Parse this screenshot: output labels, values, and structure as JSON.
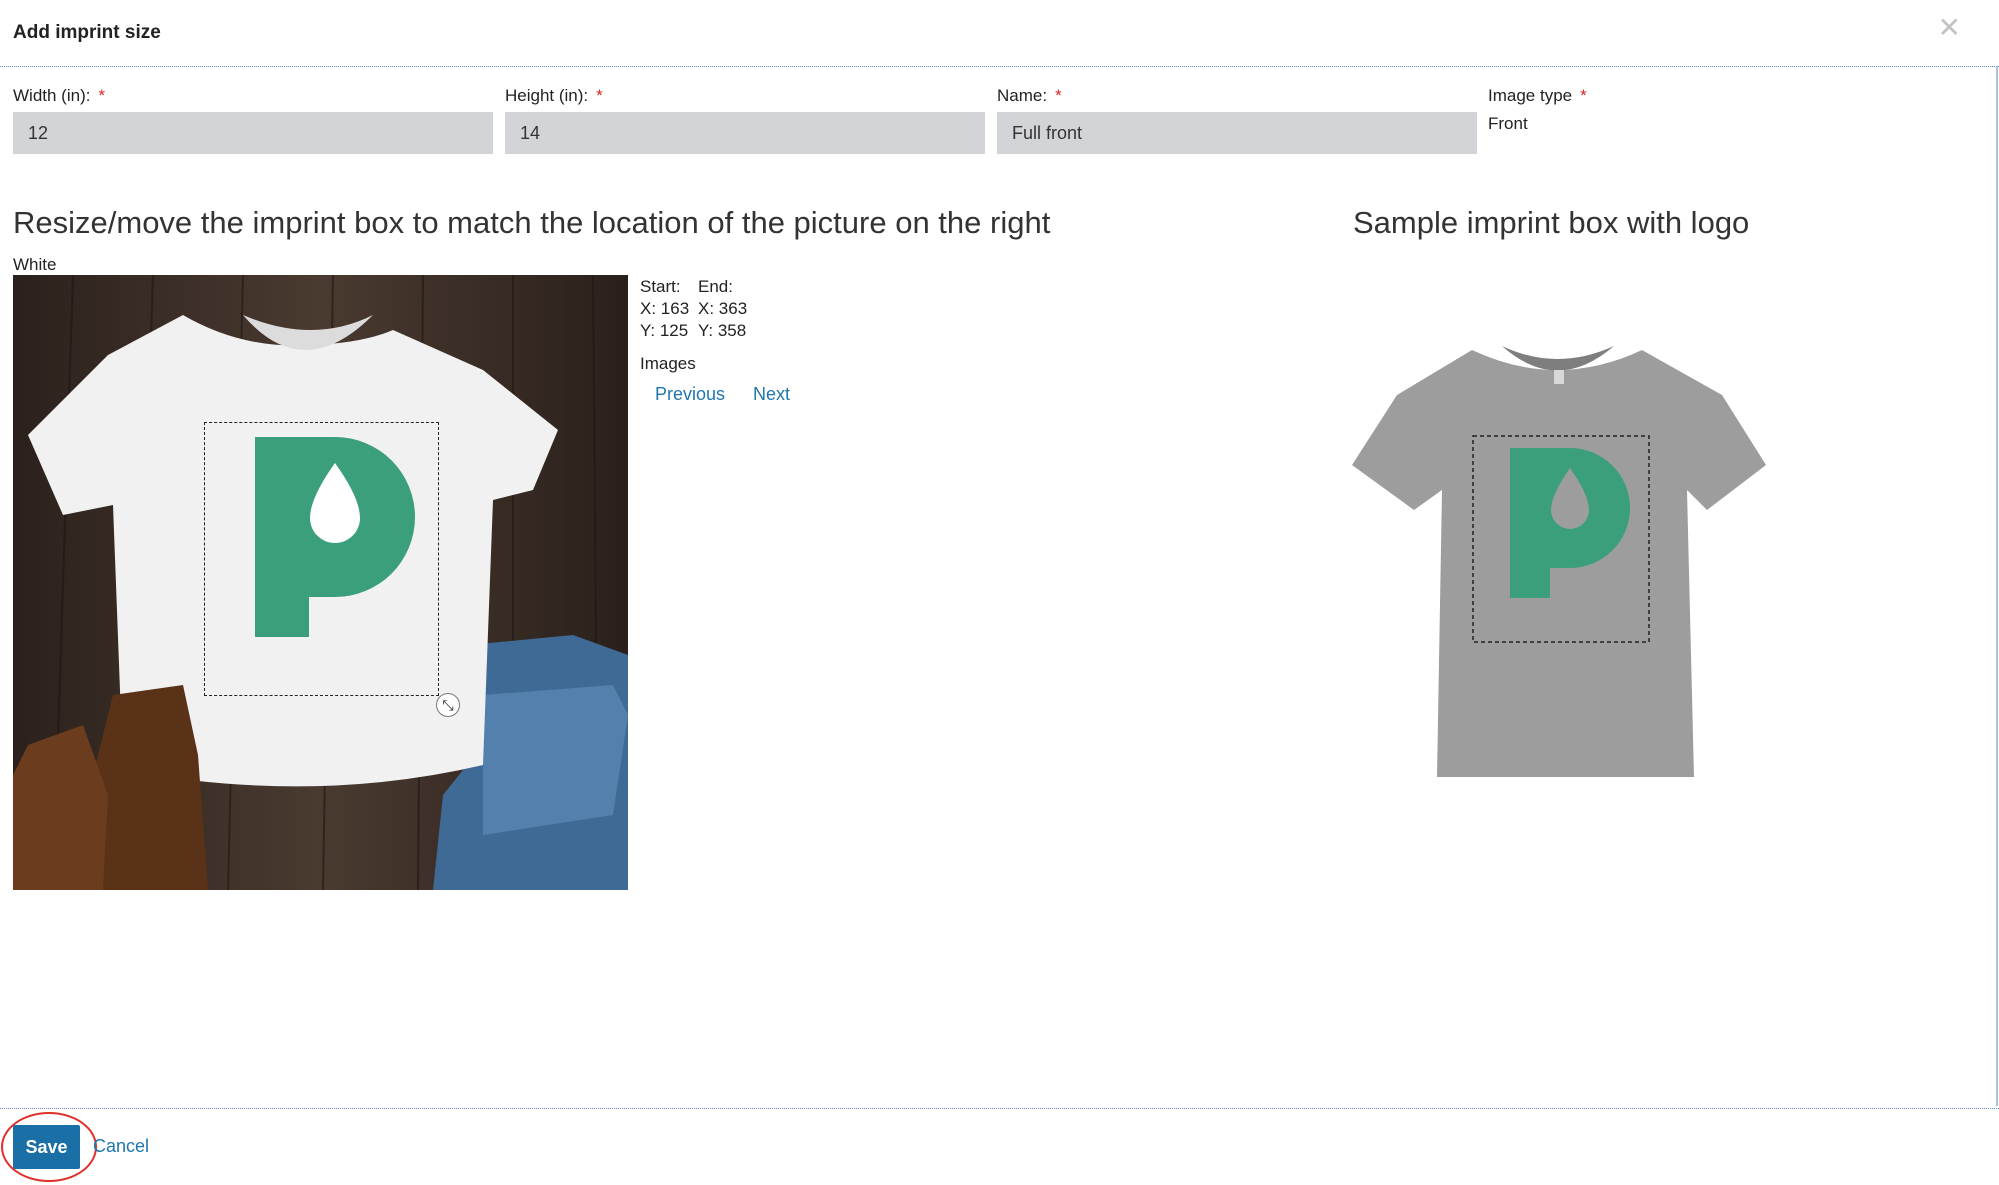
{
  "dialog": {
    "title": "Add imprint size",
    "close_icon": "close-icon"
  },
  "form": {
    "width": {
      "label": "Width (in):",
      "required_mark": "*",
      "value": "12"
    },
    "height": {
      "label": "Height (in):",
      "required_mark": "*",
      "value": "14"
    },
    "name": {
      "label": "Name:",
      "required_mark": "*",
      "value": "Full front"
    },
    "image_type": {
      "label": "Image type",
      "required_mark": "*",
      "value": "Front"
    }
  },
  "editor": {
    "heading": "Resize/move the imprint box to match the location of the picture on the right",
    "color_label": "White",
    "start_label": "Start:",
    "end_label": "End:",
    "start_x": "X: 163",
    "start_y": "Y: 125",
    "end_x": "X: 363",
    "end_y": "Y: 358",
    "images_label": "Images",
    "previous_label": "Previous",
    "next_label": "Next",
    "resize_icon": "resize-arrows-icon"
  },
  "sample": {
    "heading": "Sample imprint box with logo"
  },
  "footer": {
    "save_label": "Save",
    "cancel_label": "Cancel"
  },
  "colors": {
    "logo_green": "#3a9f7a",
    "save_button": "#1a6fa6",
    "link": "#1f76ae",
    "required": "#e02424",
    "highlight_ring": "#e0302a",
    "input_bg": "#d3d4d7"
  }
}
